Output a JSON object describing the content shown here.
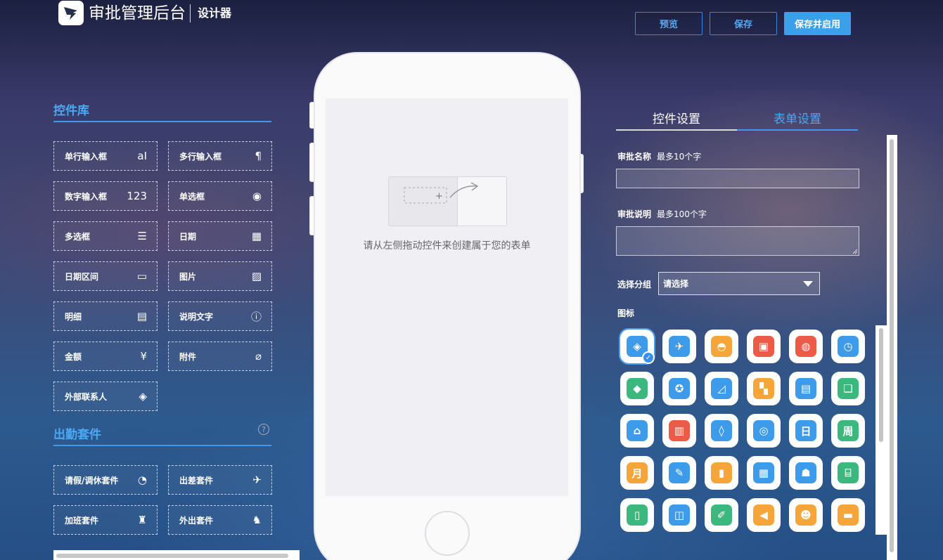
{
  "header": {
    "app_title": "审批管理后台",
    "subtitle": "设计器",
    "preview_label": "预览",
    "save_label": "保存",
    "save_enable_label": "保存并启用"
  },
  "library": {
    "title": "控件库",
    "controls": [
      {
        "label": "单行输入框",
        "icon": "text-a-icon",
        "glyph": "aI"
      },
      {
        "label": "多行输入框",
        "icon": "paragraph-icon",
        "glyph": "¶"
      },
      {
        "label": "数字输入框",
        "icon": "number-icon",
        "glyph": "123"
      },
      {
        "label": "单选框",
        "icon": "radio-icon",
        "glyph": "◉"
      },
      {
        "label": "多选框",
        "icon": "checklist-icon",
        "glyph": "☰"
      },
      {
        "label": "日期",
        "icon": "calendar-icon",
        "glyph": "▦"
      },
      {
        "label": "日期区间",
        "icon": "calendar-range-icon",
        "glyph": "▭"
      },
      {
        "label": "图片",
        "icon": "image-icon",
        "glyph": "▨"
      },
      {
        "label": "明细",
        "icon": "detail-icon",
        "glyph": "▤"
      },
      {
        "label": "说明文字",
        "icon": "info-icon",
        "glyph": "ⓘ"
      },
      {
        "label": "金额",
        "icon": "yen-icon",
        "glyph": "¥"
      },
      {
        "label": "附件",
        "icon": "paperclip-icon",
        "glyph": "⌀"
      },
      {
        "label": "外部联系人",
        "icon": "handshake-icon",
        "glyph": "◈"
      }
    ]
  },
  "attendance": {
    "title": "出勤套件",
    "help": "?",
    "kits": [
      {
        "label": "请假/调休套件",
        "icon": "clock-icon",
        "glyph": "◔"
      },
      {
        "label": "出差套件",
        "icon": "airplane-icon",
        "glyph": "✈"
      },
      {
        "label": "加班套件",
        "icon": "desk-lamp-icon",
        "glyph": "♜"
      },
      {
        "label": "外出套件",
        "icon": "walking-icon",
        "glyph": "♞"
      }
    ]
  },
  "canvas": {
    "hint": "请从左侧拖动控件来创建属于您的表单",
    "plus": "+"
  },
  "settings": {
    "tabs": [
      "控件设置",
      "表单设置"
    ],
    "active_tab": 1,
    "name_label": "审批名称",
    "name_limit": "最多10个字",
    "desc_label": "审批说明",
    "desc_limit": "最多100个字",
    "group_label": "选择分组",
    "group_value": "请选择",
    "icon_label": "图标",
    "selected_icon": 0,
    "icons": [
      {
        "name": "handshake-icon",
        "color": "#3d9be9",
        "glyph": "◈"
      },
      {
        "name": "airplane-icon",
        "color": "#3d9be9",
        "glyph": "✈"
      },
      {
        "name": "car-icon",
        "color": "#f5a53a",
        "glyph": "◓"
      },
      {
        "name": "briefcase-icon",
        "color": "#ec5a48",
        "glyph": "▣"
      },
      {
        "name": "money-bag-icon",
        "color": "#ec5a48",
        "glyph": "◍"
      },
      {
        "name": "clock-icon",
        "color": "#3d9be9",
        "glyph": "◷"
      },
      {
        "name": "box-icon",
        "color": "#3cb87e",
        "glyph": "◆"
      },
      {
        "name": "badge-icon",
        "color": "#3d9be9",
        "glyph": "✪"
      },
      {
        "name": "chart-board-icon",
        "color": "#3d9be9",
        "glyph": "◿"
      },
      {
        "name": "paint-roller-icon",
        "color": "#f5a53a",
        "glyph": "▚"
      },
      {
        "name": "card-icon",
        "color": "#3d9be9",
        "glyph": "▤"
      },
      {
        "name": "stack-icon",
        "color": "#3cb87e",
        "glyph": "❏"
      },
      {
        "name": "shop-icon",
        "color": "#3d9be9",
        "glyph": "⌂"
      },
      {
        "name": "bar-chart-icon",
        "color": "#ec5a48",
        "glyph": "▥"
      },
      {
        "name": "tag-icon",
        "color": "#3d9be9",
        "glyph": "◊"
      },
      {
        "name": "eye-icon",
        "color": "#3d9be9",
        "glyph": "◎"
      },
      {
        "name": "day-icon",
        "color": "#3d9be9",
        "glyph": "日"
      },
      {
        "name": "week-icon",
        "color": "#3cb87e",
        "glyph": "周"
      },
      {
        "name": "month-icon",
        "color": "#f5a53a",
        "glyph": "月"
      },
      {
        "name": "user-edit-icon",
        "color": "#3d9be9",
        "glyph": "✎"
      },
      {
        "name": "book-icon",
        "color": "#f5a53a",
        "glyph": "▮"
      },
      {
        "name": "document-icon",
        "color": "#3d9be9",
        "glyph": "▦"
      },
      {
        "name": "archive-icon",
        "color": "#3d9be9",
        "glyph": "☗"
      },
      {
        "name": "bank-icon",
        "color": "#3cb87e",
        "glyph": "⌸"
      },
      {
        "name": "notebook-icon",
        "color": "#3cb87e",
        "glyph": "▯"
      },
      {
        "name": "open-book-icon",
        "color": "#3d9be9",
        "glyph": "◫"
      },
      {
        "name": "pen-icon",
        "color": "#3cb87e",
        "glyph": "✐"
      },
      {
        "name": "megaphone-icon",
        "color": "#f5a53a",
        "glyph": "◀"
      },
      {
        "name": "person-card-icon",
        "color": "#f5a53a",
        "glyph": "☻"
      },
      {
        "name": "folder-icon",
        "color": "#f5a53a",
        "glyph": "▬"
      }
    ]
  }
}
